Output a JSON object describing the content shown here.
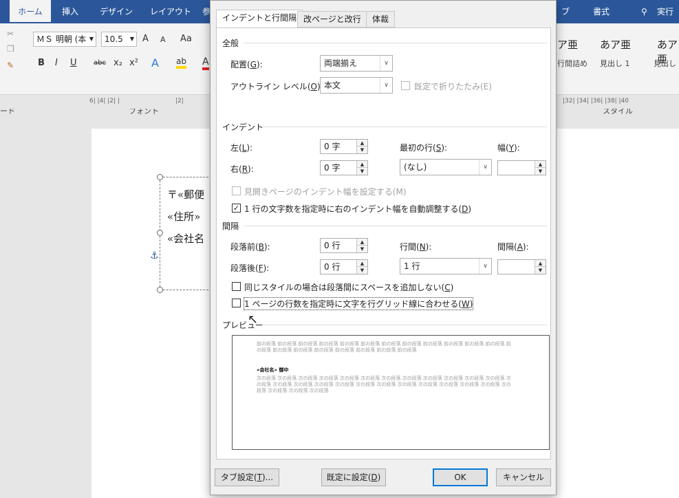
{
  "ribbon": {
    "tabs": [
      "ホーム",
      "挿入",
      "デザイン",
      "レイアウト",
      "参",
      "ブ",
      "書式",
      "実行"
    ],
    "tell_me_icon": "lightbulb-icon",
    "font_name": "ＭＳ 明朝 (本",
    "font_size": "10.5",
    "group_font_label": "フォント",
    "group_style_label": "スタイル",
    "left_group_label": "ード",
    "styles": [
      {
        "sample": "ア亜",
        "name": "行間詰め"
      },
      {
        "sample": "あア亜",
        "name": "見出し 1"
      },
      {
        "sample": "あア亜",
        "name": "見出し"
      }
    ],
    "buttons": {
      "bold": "B",
      "italic": "I",
      "underline": "U",
      "strike": "abc",
      "subscript": "x₂",
      "superscript": "x²",
      "grow": "A",
      "shrink": "A",
      "case": "Aa"
    }
  },
  "ruler": {
    "left_ticks": "6| |4| |2| |",
    "left_ticks2": "|2|",
    "right_ticks": "|32| |34| |36| |38| |40"
  },
  "document": {
    "lines": [
      "〒«郵便",
      "«住所»",
      "«会社名"
    ]
  },
  "dialog": {
    "tabs": [
      "インデントと行間隔",
      "改ページと改行",
      "体裁"
    ],
    "general": {
      "title": "全般",
      "alignment_label": "配置(",
      "alignment_key": "G",
      "alignment_suffix": "):",
      "alignment_value": "両端揃え",
      "outline_label": "アウトライン レベル(",
      "outline_key": "O",
      "outline_suffix": "):",
      "outline_value": "本文",
      "collapse_label": "既定で折りたたみ(E)"
    },
    "indent": {
      "title": "インデント",
      "left_label": "左(",
      "left_key": "L",
      "left_suffix": "):",
      "left_value": "0 字",
      "right_label": "右(",
      "right_key": "R",
      "right_suffix": "):",
      "right_value": "0 字",
      "first_line_label": "最初の行(",
      "first_line_key": "S",
      "first_line_suffix": "):",
      "first_line_value": "(なし)",
      "width_label": "幅(",
      "width_key": "Y",
      "width_suffix": "):",
      "width_value": "",
      "mirror_label": "見開きページのインデント幅を設定する(M)",
      "auto_adjust_label": "1 行の文字数を指定時に右のインデント幅を自動調整する(",
      "auto_adjust_key": "D",
      "auto_adjust_suffix": ")"
    },
    "spacing": {
      "title": "間隔",
      "before_label": "段落前(",
      "before_key": "B",
      "before_suffix": "):",
      "before_value": "0 行",
      "after_label": "段落後(",
      "after_key": "F",
      "after_suffix": "):",
      "after_value": "0 行",
      "line_spacing_label": "行間(",
      "line_spacing_key": "N",
      "line_spacing_suffix": "):",
      "line_spacing_value": "1 行",
      "at_label": "間隔(",
      "at_key": "A",
      "at_suffix": "):",
      "at_value": "",
      "no_space_label": "同じスタイルの場合は段落間にスペースを追加しない(",
      "no_space_key": "C",
      "no_space_suffix": ")",
      "snap_grid_label": "1 ページの行数を指定時に文字を行グリッド線に合わせる(",
      "snap_grid_key": "W",
      "snap_grid_suffix": ")"
    },
    "preview": {
      "title": "プレビュー",
      "prev_text": "前の段落 前の段落 前の段落 前の段落 前の段落 前の段落 前の段落 前の段落 前の段落 前の段落 前の段落 前の段落 前の段落 前の段落 前の段落 前の段落 前の段落 前の段落 前の段落 前の段落",
      "main_text": "«会社名» 御中",
      "next_text": "次の段落 次の段落 次の段落 次の段落 次の段落 次の段落 次の段落 次の段落 次の段落 次の段落 次の段落 次の段落 次の段落 次の段落 次の段落 次の段落 次の段落 次の段落 次の段落 次の段落 次の段落 次の段落 次の段落 次の段落 次の段落 次の段落 次の段落 次の段落"
    },
    "buttons": {
      "tabs_label": "タブ設定(",
      "tabs_key": "T",
      "tabs_suffix": ")...",
      "default_label": "既定に設定(",
      "default_key": "D",
      "default_suffix": ")",
      "ok": "OK",
      "cancel": "キャンセル"
    }
  }
}
